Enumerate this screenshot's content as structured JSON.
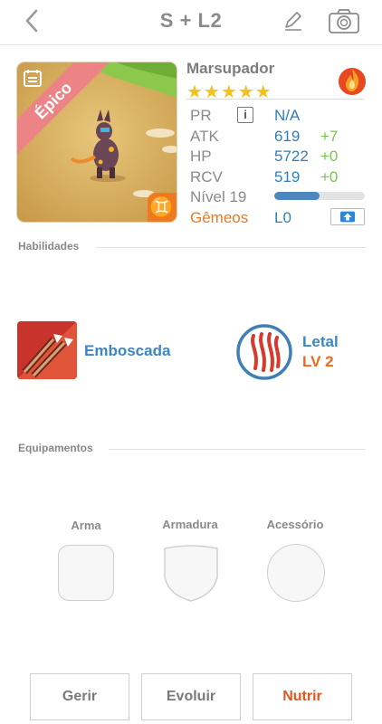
{
  "header": {
    "title": "S + L2"
  },
  "pet": {
    "rarity": "Épico",
    "name": "Marsupador",
    "stars": "★★★★★",
    "zodiac_symbol": "♊",
    "element": "fire"
  },
  "stats": {
    "pr": {
      "label": "PR",
      "info": "i",
      "value": "N/A"
    },
    "atk": {
      "label": "ATK",
      "value": "619",
      "bonus": "+7"
    },
    "hp": {
      "label": "HP",
      "value": "5722",
      "bonus": "+0"
    },
    "rcv": {
      "label": "RCV",
      "value": "519",
      "bonus": "+0"
    },
    "level": {
      "label": "Nível 19",
      "progress": 0.5
    },
    "gemeos": {
      "label": "Gêmeos",
      "value": "L0"
    }
  },
  "abilities": {
    "section_label": "Habilidades",
    "skill_name": "Emboscada",
    "trait_name": "Letal",
    "trait_level": "LV 2"
  },
  "equipment": {
    "section_label": "Equipamentos",
    "slots": [
      "Arma",
      "Armadura",
      "Acessório"
    ]
  },
  "actions": {
    "manage": "Gerir",
    "evolve": "Evoluir",
    "feed": "Nutrir"
  },
  "colors": {
    "accent_blue": "#3d86c3",
    "accent_orange": "#ed7a21",
    "bonus_green": "#78c64a",
    "star_gold": "#f3c21c",
    "rarity_pink": "#ec8486"
  }
}
